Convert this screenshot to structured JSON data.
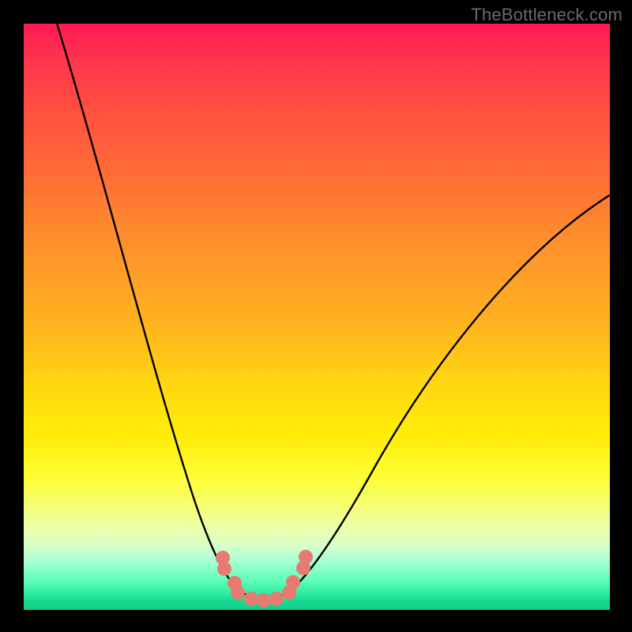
{
  "watermark": "TheBottleneck.com",
  "colors": {
    "frame": "#000000",
    "gradient_top": "#ff1a55",
    "gradient_mid": "#ffd810",
    "gradient_bottom": "#0fcf85",
    "curve": "#000000",
    "markers": "#e77a71",
    "watermark_text": "#6a6a6a"
  },
  "chart_data": {
    "type": "line",
    "title": "",
    "xlabel": "",
    "ylabel": "",
    "xlim": [
      0,
      100
    ],
    "ylim": [
      0,
      100
    ],
    "grid": false,
    "legend": false,
    "background": "vertical-rainbow-gradient (red top → green bottom) representing bottleneck severity",
    "series": [
      {
        "name": "bottleneck-curve",
        "description": "V-shaped curve; y ≈ 100 means severe bottleneck (red), y ≈ 0 means balanced (green). Minimum near x ≈ 41.",
        "x": [
          5,
          12,
          20,
          27,
          32,
          35,
          37,
          39,
          41,
          43,
          45,
          48,
          55,
          65,
          80,
          95,
          100
        ],
        "values": [
          100,
          80,
          55,
          35,
          20,
          12,
          6,
          3,
          2,
          3,
          6,
          12,
          28,
          48,
          62,
          70,
          72
        ]
      }
    ],
    "markers": {
      "name": "highlighted-points",
      "color": "#e77a71",
      "shape": "circle",
      "x": [
        34,
        34.3,
        36,
        36.5,
        39,
        41,
        43,
        45.5,
        46,
        47.7,
        48
      ],
      "values": [
        9,
        7,
        4,
        2.7,
        1.6,
        1.4,
        1.6,
        2.7,
        4.4,
        7,
        9
      ]
    }
  }
}
